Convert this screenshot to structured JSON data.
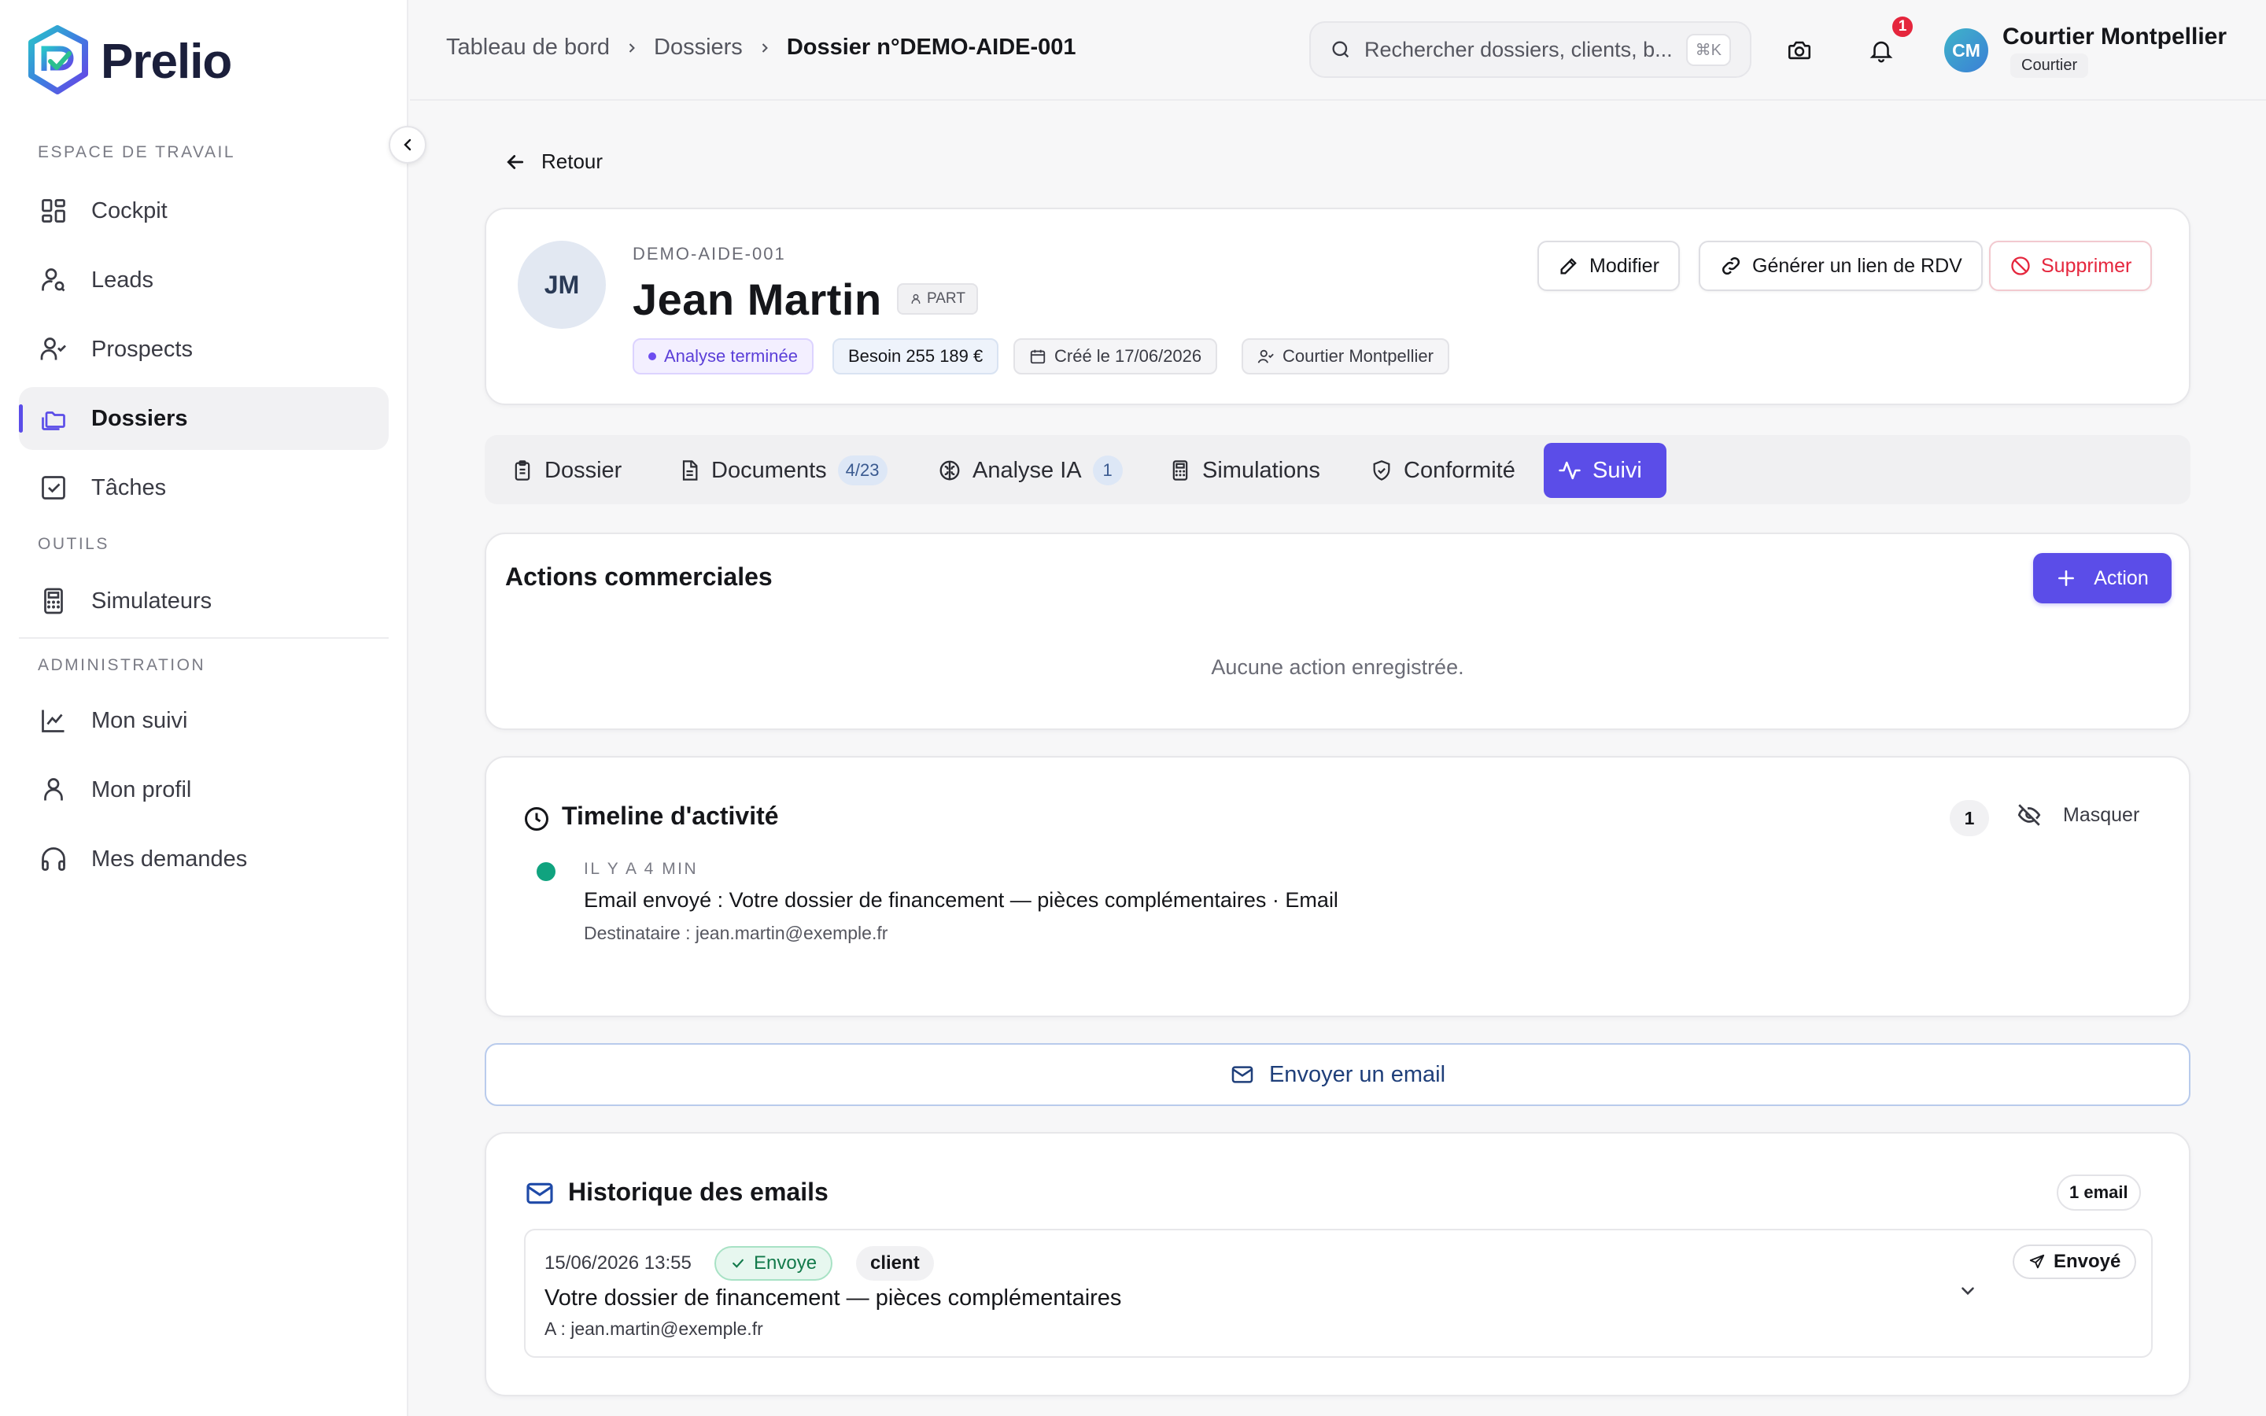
{
  "app": {
    "name": "Prelio"
  },
  "sidebar": {
    "sections": [
      {
        "label": "ESPACE DE TRAVAIL"
      },
      {
        "label": "OUTILS"
      },
      {
        "label": "ADMINISTRATION"
      }
    ],
    "items": [
      {
        "label": "Cockpit",
        "icon": "dashboard-icon"
      },
      {
        "label": "Leads",
        "icon": "user-search-icon"
      },
      {
        "label": "Prospects",
        "icon": "user-check-icon"
      },
      {
        "label": "Dossiers",
        "icon": "folders-icon",
        "active": true
      },
      {
        "label": "Tâches",
        "icon": "checkbox-icon"
      },
      {
        "label": "Simulateurs",
        "icon": "calculator-icon"
      },
      {
        "label": "Mon suivi",
        "icon": "chart-line-icon"
      },
      {
        "label": "Mon profil",
        "icon": "user-icon"
      },
      {
        "label": "Mes demandes",
        "icon": "headset-icon"
      }
    ]
  },
  "topbar": {
    "breadcrumb": [
      "Tableau de bord",
      "Dossiers",
      "Dossier n°DEMO-AIDE-001"
    ],
    "search_placeholder": "Rechercher dossiers, clients, b...",
    "search_shortcut": "⌘K",
    "notification_count": "1",
    "user": {
      "initials": "CM",
      "name": "Courtier Montpellier",
      "role": "Courtier"
    }
  },
  "main": {
    "back_label": "Retour",
    "client": {
      "initials": "JM",
      "ref": "DEMO-AIDE-001",
      "name": "Jean Martin",
      "type_badge": "PART",
      "status": "Analyse terminée",
      "need": "Besoin 255 189 €",
      "created": "Créé le 17/06/2026",
      "owner": "Courtier Montpellier"
    },
    "header_actions": {
      "edit": "Modifier",
      "link": "Générer un lien de RDV",
      "delete": "Supprimer"
    },
    "tabs": [
      {
        "label": "Dossier"
      },
      {
        "label": "Documents",
        "count": "4/23"
      },
      {
        "label": "Analyse IA",
        "count": "1"
      },
      {
        "label": "Simulations"
      },
      {
        "label": "Conformité"
      },
      {
        "label": "Suivi",
        "active": true
      }
    ],
    "actions": {
      "title": "Actions commerciales",
      "add_label": "Action",
      "empty": "Aucune action enregistrée."
    },
    "timeline": {
      "title": "Timeline d'activité",
      "count": "1",
      "hide_label": "Masquer",
      "events": [
        {
          "time": "IL Y A 4 MIN",
          "text": "Email envoyé : Votre dossier de financement — pièces complémentaires · Email",
          "sub": "Destinataire : jean.martin@exemple.fr"
        }
      ]
    },
    "send_email_label": "Envoyer un email",
    "email_history": {
      "title": "Historique des emails",
      "count_label": "1 email",
      "emails": [
        {
          "date": "15/06/2026 13:55",
          "status": "Envoye",
          "audience": "client",
          "subject": "Votre dossier de financement — pièces complémentaires",
          "to": "A : jean.martin@exemple.fr",
          "sent_label": "Envoyé"
        }
      ]
    }
  },
  "colors": {
    "accent": "#5b4de8",
    "success": "#10a37f",
    "danger": "#e5263d",
    "email_blue": "#1f3f7a"
  }
}
